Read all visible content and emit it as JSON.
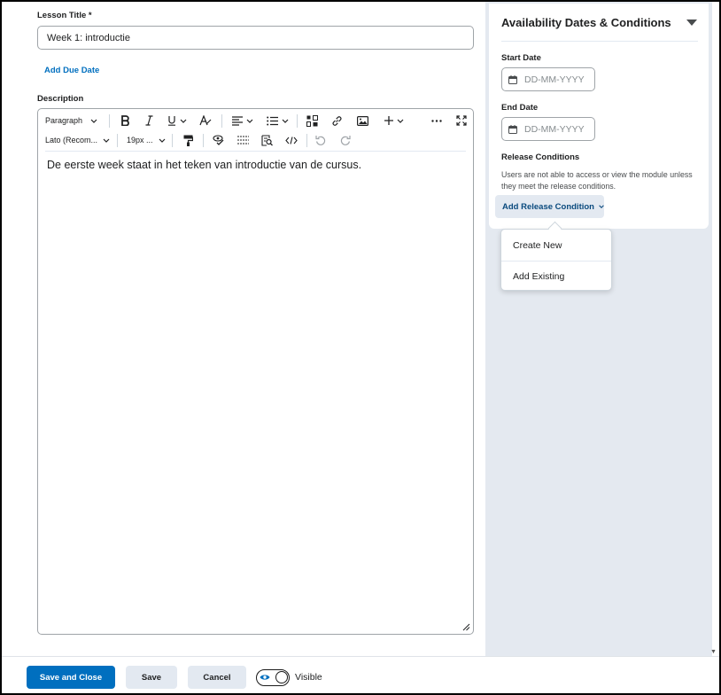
{
  "form": {
    "lesson_title_label": "Lesson Title *",
    "lesson_title_value": "Week 1: introductie",
    "add_due_date": "Add Due Date",
    "description_label": "Description"
  },
  "editor": {
    "toolbar": {
      "paragraph": "Paragraph",
      "font": "Lato (Recom...",
      "size": "19px ..."
    },
    "content": "De eerste week staat in het teken van introductie van de cursus."
  },
  "availability": {
    "title": "Availability Dates & Conditions",
    "start_date_label": "Start Date",
    "start_date_placeholder": "DD-MM-YYYY",
    "end_date_label": "End Date",
    "end_date_placeholder": "DD-MM-YYYY",
    "release_conditions_label": "Release Conditions",
    "release_conditions_desc": "Users are not able to access or view the module unless they meet the release conditions.",
    "add_release_condition": "Add Release Condition",
    "dropdown": [
      "Create New",
      "Add Existing"
    ]
  },
  "footer": {
    "save_close": "Save and Close",
    "save": "Save",
    "cancel": "Cancel",
    "visible": "Visible"
  },
  "icons": {
    "bold": "bold-icon",
    "italic": "italic-icon",
    "underline": "underline-icon",
    "format": "clear-format-icon",
    "align": "align-icon",
    "list": "list-icon",
    "element": "insert-element-icon",
    "link": "link-icon",
    "image": "image-icon",
    "add": "plus-icon",
    "more": "more-icon",
    "fullscreen": "fullscreen-icon",
    "paint": "format-painter-icon",
    "spellcheck": "accessibility-check-icon",
    "hr": "horizontal-rule-icon",
    "find": "find-replace-icon",
    "code": "source-code-icon",
    "undo": "undo-icon",
    "redo": "redo-icon",
    "calendar": "calendar-icon"
  },
  "colors": {
    "primary": "#006fbf",
    "panel_bg": "#e4e9f0",
    "secondary_btn": "#e3e9f1"
  }
}
